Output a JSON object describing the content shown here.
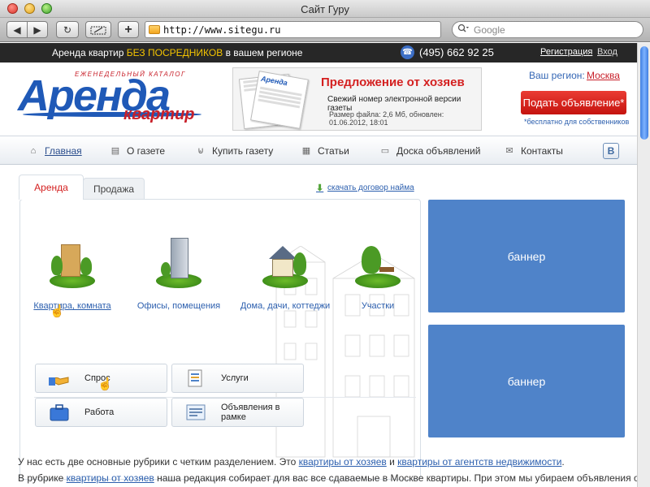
{
  "window": {
    "title": "Сайт Гуру"
  },
  "browser": {
    "url": "http://www.sitegu.ru",
    "search_placeholder": "Google",
    "add_label": "+"
  },
  "topbar": {
    "tagline_start": "Аренда квартир ",
    "tagline_highlight": "БЕЗ ПОСРЕДНИКОВ",
    "tagline_end": " в вашем регионе",
    "phone": "(495) 662 92 25",
    "register": "Регистрация",
    "login": "Вход"
  },
  "logo": {
    "subtitle": "ЕЖЕНЕДЕЛЬНЫЙ КАТАЛОГ",
    "main": "Аренда",
    "small": "квартир"
  },
  "promo": {
    "paper_title": "Аренда",
    "title": "Предложение от хозяев",
    "text": "Свежий номер электронной версии газеты",
    "meta": "Размер файла: 2,6 Мб, обновлен: 01.06.2012, 18:01"
  },
  "region": {
    "label": "Ваш регион:",
    "city": "Москва",
    "submit": "Подать объявление*",
    "note": "*бесплатно для собственников"
  },
  "nav": {
    "items": [
      {
        "label": "Главная",
        "icon": "home-icon"
      },
      {
        "label": "О газете",
        "icon": "newspaper-icon"
      },
      {
        "label": "Купить газету",
        "icon": "basket-icon"
      },
      {
        "label": "Статьи",
        "icon": "document-icon"
      },
      {
        "label": "Доска объявлений",
        "icon": "board-icon"
      },
      {
        "label": "Контакты",
        "icon": "envelope-icon"
      }
    ],
    "social": "В"
  },
  "tabs": {
    "rent": "Аренда",
    "sale": "Продажа"
  },
  "download": "скачать договор найма",
  "categories": [
    {
      "label": "Квартира, комната"
    },
    {
      "label": "Офисы, помещения"
    },
    {
      "label": "Дома, дачи, коттеджи"
    },
    {
      "label": "Участки"
    }
  ],
  "sub_buttons": [
    {
      "label": "Спрос",
      "icon": "handshake-icon"
    },
    {
      "label": "Услуги",
      "icon": "services-icon"
    },
    {
      "label": "Работа",
      "icon": "briefcase-icon"
    },
    {
      "label": "Объявления в рамке",
      "icon": "framed-ads-icon"
    }
  ],
  "banners": [
    "баннер",
    "баннер"
  ],
  "paragraphs": {
    "p1_a": "У нас есть две основные рубрики с четким разделением. Это ",
    "p1_link1": "квартиры от хозяев",
    "p1_b": " и ",
    "p1_link2": "квартиры от агентств недвижимости",
    "p1_c": ".",
    "p2_a": "В рубрике ",
    "p2_link": "квартиры от хозяев",
    "p2_b": " наша редакция собирает для вас все сдаваемые в Москве квартиры. При этом мы убираем объявления от агентств,"
  },
  "colors": {
    "brand_blue": "#1f59b7",
    "brand_red": "#d42020",
    "banner_blue": "#4f83c9",
    "link_blue": "#2c5fae",
    "highlight_yellow": "#f4c400"
  }
}
